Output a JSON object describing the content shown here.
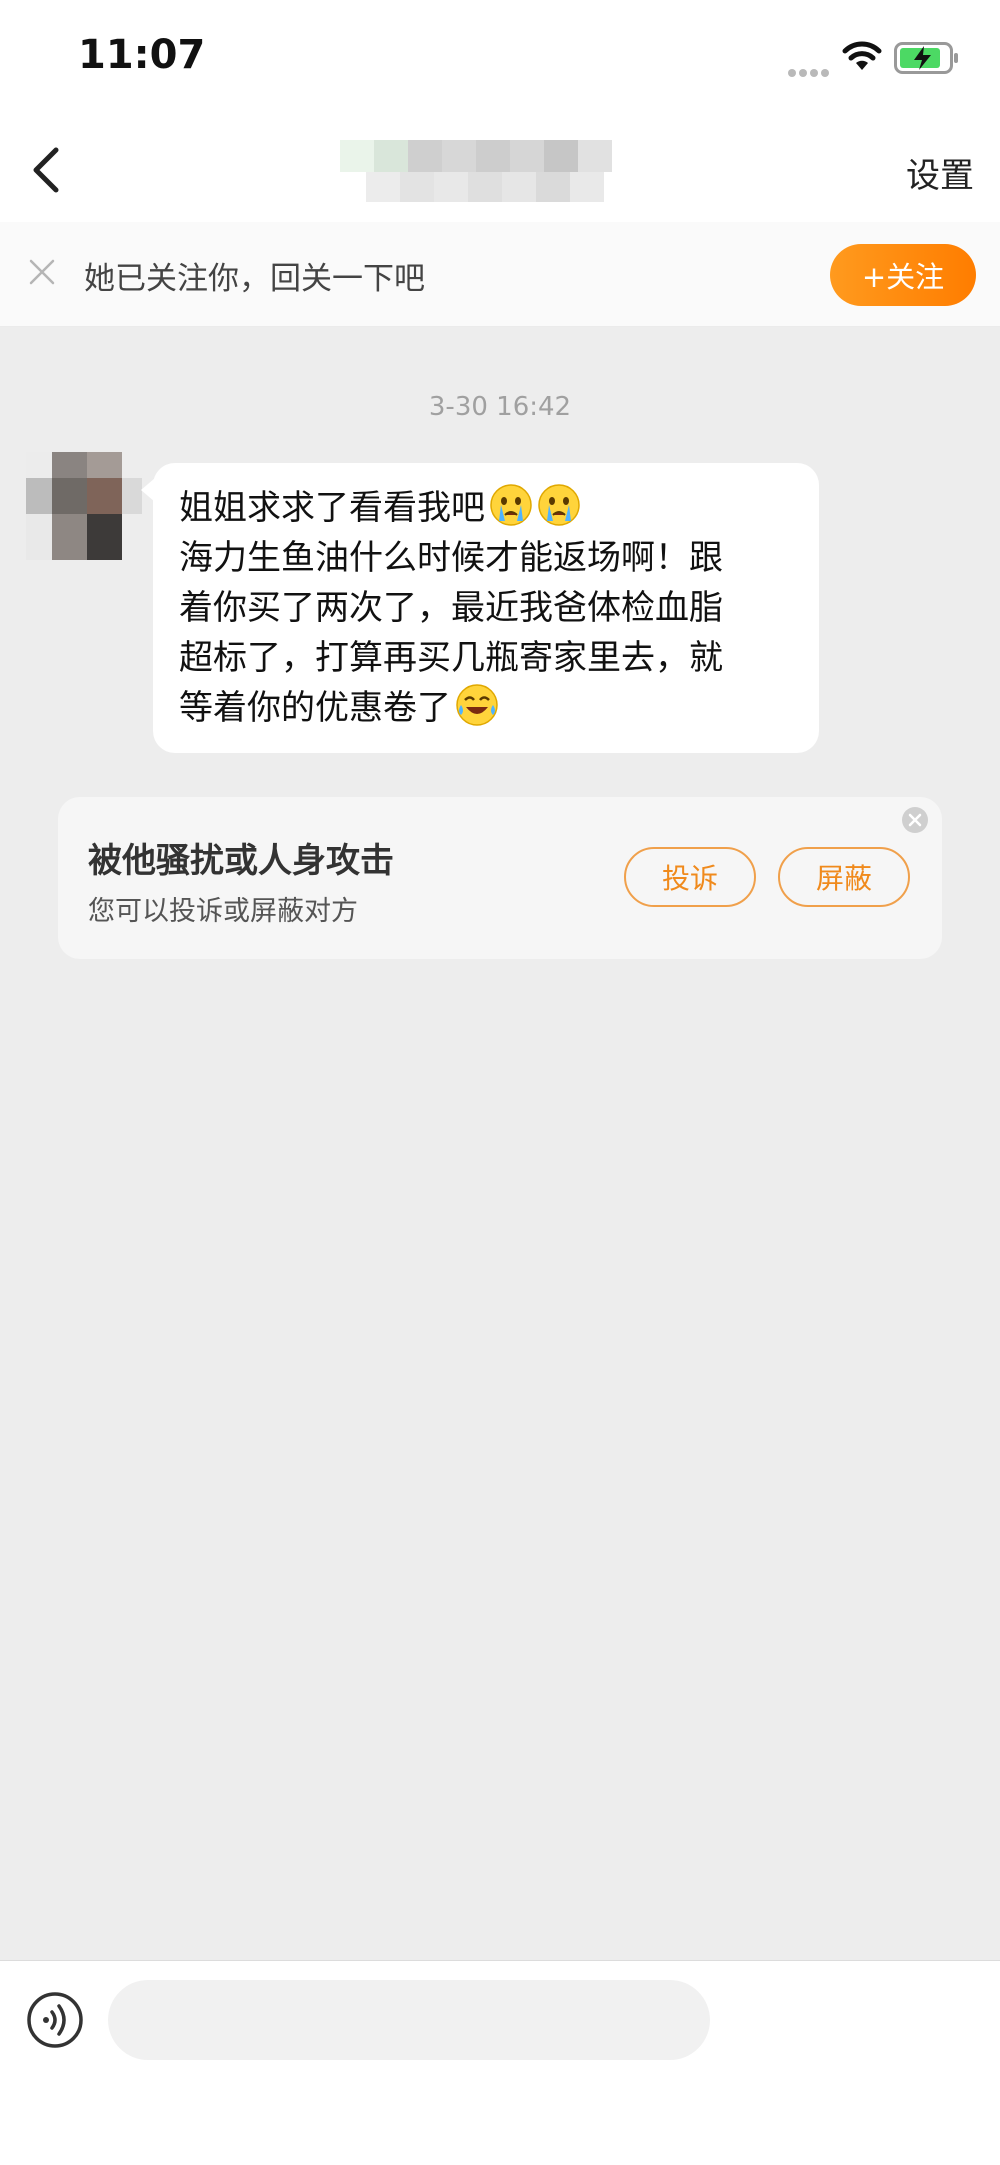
{
  "status_bar": {
    "time": "11:07",
    "icons": [
      "signal-icon",
      "wifi-icon",
      "battery-charging-icon"
    ],
    "battery_color": "#4cd964"
  },
  "nav": {
    "back_icon": "chevron-left-icon",
    "title": "",
    "settings_label": "设置"
  },
  "follow_banner": {
    "close_icon": "close-icon",
    "text": "她已关注你，回关一下吧",
    "button_label": "+关注",
    "button_color": "#ff8a00"
  },
  "conversation": {
    "timestamp": "3-30 16:42",
    "message": {
      "lines": [
        "姐姐求求了看看我吧",
        "海力生鱼油什么时候才能返场啊！跟",
        "着你买了两次了，最近我爸体检血脂",
        "超标了，打算再买几瓶寄家里去，就",
        "等着你的优惠卷了"
      ],
      "emojis": [
        "crying-emoji",
        "crying-emoji",
        "laughing-tears-emoji"
      ]
    }
  },
  "harassment_card": {
    "title": "被他骚扰或人身攻击",
    "subtitle": "您可以投诉或屏蔽对方",
    "report_label": "投诉",
    "block_label": "屏蔽",
    "accent_color": "#f08a1c"
  },
  "input_bar": {
    "voice_icon": "voice-icon",
    "placeholder": ""
  }
}
